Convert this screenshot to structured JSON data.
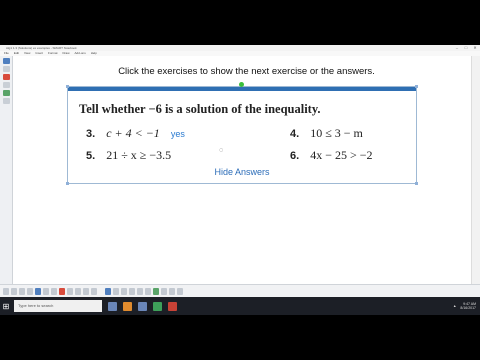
{
  "window": {
    "title": "Alg1 1.3 (Solutions) ex examples - SMART Notebook",
    "controls": {
      "minimize": "–",
      "maximize": "□",
      "close": "✕"
    }
  },
  "menu": {
    "items": [
      "File",
      "Edit",
      "View",
      "Insert",
      "Format",
      "Draw",
      "Add-ons",
      "Help"
    ]
  },
  "canvas": {
    "instruction": "Click the exercises to show the next exercise or the answers.",
    "widget": {
      "question": "Tell whether −6 is a solution of the inequality.",
      "exercises": [
        {
          "num": "3.",
          "expr": "c + 4 < −1",
          "answer": "yes"
        },
        {
          "num": "4.",
          "expr": "10 ≤ 3 − m",
          "answer": ""
        },
        {
          "num": "5.",
          "expr": "21 ÷ x ≥ −3.5",
          "answer": ""
        },
        {
          "num": "6.",
          "expr": "4x − 25 > −2",
          "answer": ""
        }
      ],
      "hide_answers": "Hide Answers"
    }
  },
  "taskbar": {
    "search_placeholder": "Type here to search",
    "time": "9:47 AM",
    "date": "8/16/2017"
  },
  "colors": {
    "widget_bar": "#2f6fb3",
    "answer": "#2b7bd0",
    "handle": "#3bbf3b"
  }
}
